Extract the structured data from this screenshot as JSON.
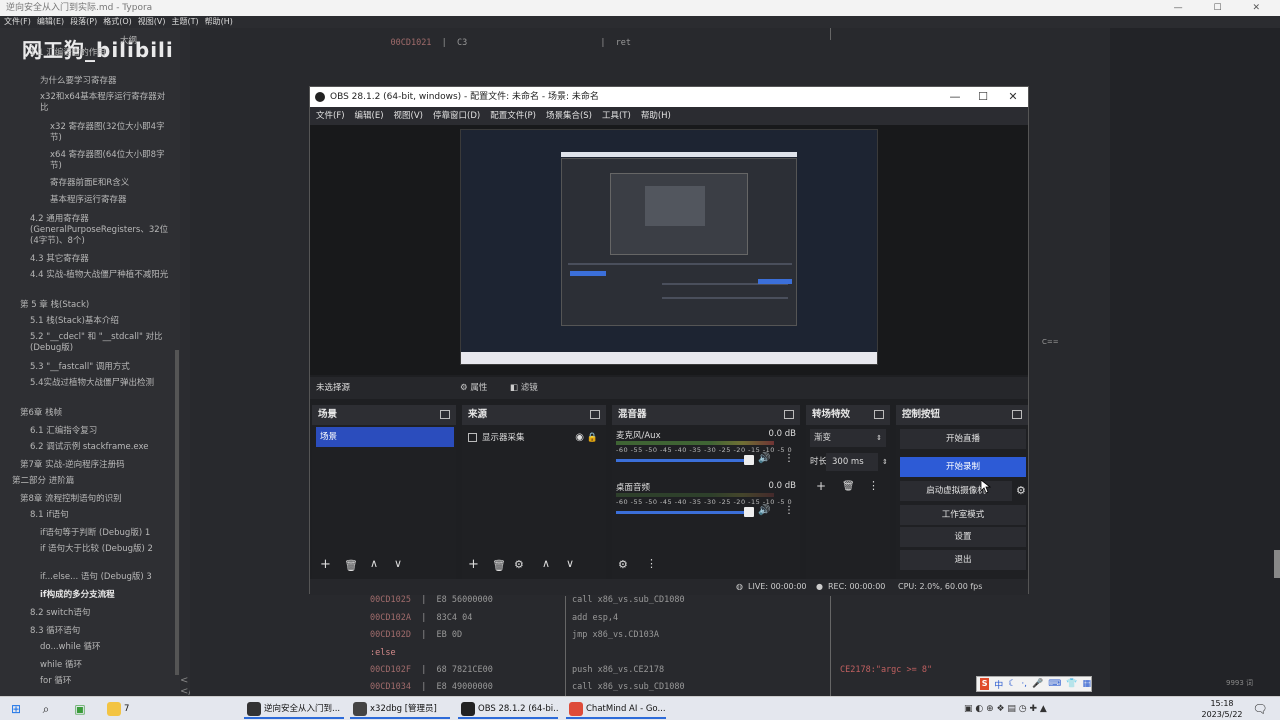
{
  "typora": {
    "window_title": "逆向安全从入门到实际.md - Typora",
    "menu": [
      "文件(F)",
      "编辑(E)",
      "段落(P)",
      "格式(O)",
      "视图(V)",
      "主题(T)",
      "帮助(H)"
    ],
    "watermark": "网工狗_bilibili",
    "outline": [
      {
        "text": "大纲",
        "bold": false
      },
      {
        "text": "1.1 汇编语言的作用",
        "bold": false
      },
      {
        "text": "为什么要学习寄存器",
        "bold": false
      },
      {
        "text": "x32和x64基本程序运行寄存器对比",
        "bold": false
      },
      {
        "text": "x32 寄存器图(32位大小即4字节)",
        "bold": false
      },
      {
        "text": "x64 寄存器图(64位大小即8字节)",
        "bold": false
      },
      {
        "text": "寄存器前面E和R含义",
        "bold": false
      },
      {
        "text": "基本程序运行寄存器",
        "bold": false
      },
      {
        "text": "4.2 通用寄存器(GeneralPurposeRegisters、32位(4字节)、8个)",
        "bold": false
      },
      {
        "text": "4.3 其它寄存器",
        "bold": false
      },
      {
        "text": "4.4 实战-植物大战僵尸种植不减阳光",
        "bold": false
      },
      {
        "text": "第 5 章 栈(Stack)",
        "bold": false
      },
      {
        "text": "5.1 栈(Stack)基本介绍",
        "bold": false
      },
      {
        "text": "5.2 \"__cdecl\" 和 \"__stdcall\" 对比(Debug版)",
        "bold": false
      },
      {
        "text": "5.3 \"__fastcall\" 调用方式",
        "bold": false
      },
      {
        "text": "5.4实战过植物大战僵尸弹出检测",
        "bold": false
      },
      {
        "text": "第6章 栈帧",
        "bold": false
      },
      {
        "text": "6.1 汇编指令复习",
        "bold": false
      },
      {
        "text": "6.2 调试示例 stackframe.exe",
        "bold": false
      },
      {
        "text": "第7章 实战-逆向程序注册码",
        "bold": false
      },
      {
        "text": "第二部分 进阶篇",
        "bold": false
      },
      {
        "text": "第8章 流程控制语句的识别",
        "bold": false
      },
      {
        "text": "8.1 if语句",
        "bold": false
      },
      {
        "text": "if语句等于判断 (Debug版) 1",
        "bold": false
      },
      {
        "text": "if 语句大于比较 (Debug版) 2",
        "bold": false
      },
      {
        "text": "if...else... 语句 (Debug版) 3",
        "bold": false
      },
      {
        "text": "if构成的多分支流程",
        "bold": true
      },
      {
        "text": "8.2 switch语句",
        "bold": false
      },
      {
        "text": "8.3 循环语句",
        "bold": false
      },
      {
        "text": "do...while 循环",
        "bold": false
      },
      {
        "text": "while 循环",
        "bold": false
      },
      {
        "text": "for 循环",
        "bold": false
      }
    ],
    "sidebar_bottom": "< </>",
    "code_top": {
      "addr": "00CD1021",
      "bytes": "C3",
      "instr": "ret"
    },
    "code_lines": [
      {
        "addr": "00CD1025",
        "bytes": "E8 56000000",
        "instr": "call x86_vs.sub_CD1080",
        "comment": ""
      },
      {
        "addr": "00CD102A",
        "bytes": "83C4 04",
        "instr": "add esp,4",
        "comment": ""
      },
      {
        "addr": "00CD102D",
        "bytes": "EB 0D",
        "instr": "jmp x86_vs.CD103A",
        "comment": ""
      },
      {
        "addr": ":else",
        "bytes": "",
        "instr": "",
        "comment": ""
      },
      {
        "addr": "00CD102F",
        "bytes": "68 7821CE00",
        "instr": "push x86_vs.CE2178",
        "comment": "CE2178:\"argc >= 8\""
      },
      {
        "addr": "00CD1034",
        "bytes": "E8 49000000",
        "instr": "call x86_vs.sub_CD1080",
        "comment": ""
      }
    ],
    "right_marker": "C==",
    "word_count": "9993 词"
  },
  "obs": {
    "title": "OBS 28.1.2 (64-bit, windows) - 配置文件: 未命名 - 场景: 未命名",
    "menu": [
      "文件(F)",
      "编辑(E)",
      "视图(V)",
      "停靠窗口(D)",
      "配置文件(P)",
      "场景集合(S)",
      "工具(T)",
      "帮助(H)"
    ],
    "no_source": "未选择源",
    "properties_btn": "属性",
    "filters_btn": "滤镜",
    "docks": {
      "scenes": {
        "title": "场景",
        "items": [
          "场景"
        ]
      },
      "sources": {
        "title": "来源",
        "items": [
          "显示器采集"
        ]
      },
      "mixer": {
        "title": "混音器",
        "channels": [
          {
            "name": "麦克风/Aux",
            "db": "0.0 dB",
            "level": 0.75
          },
          {
            "name": "桌面音频",
            "db": "0.0 dB",
            "level": 0.95
          }
        ],
        "scale": "-60 -55 -50 -45 -40 -35 -30 -25 -20 -15 -10 -5 0"
      },
      "transitions": {
        "title": "转场特效",
        "selected": "渐变",
        "duration_label": "时长",
        "duration": "300 ms"
      },
      "controls": {
        "title": "控制按钮",
        "buttons": [
          "开始直播",
          "开始录制",
          "启动虚拟摄像机",
          "工作室模式",
          "设置",
          "退出"
        ],
        "active": "开始录制"
      }
    },
    "status": {
      "live": "LIVE: 00:00:00",
      "rec": "REC: 00:00:00",
      "cpu": "CPU: 2.0%, 60.00 fps"
    }
  },
  "ime": {
    "label": "中"
  },
  "taskbar": {
    "items": [
      {
        "label": "7",
        "color": "#f3c443"
      },
      {
        "label": "逆向安全从入门到...",
        "color": "#333333"
      },
      {
        "label": "x32dbg [管理员]",
        "color": "#444444"
      },
      {
        "label": "OBS 28.1.2 (64-bi...",
        "color": "#222222"
      },
      {
        "label": "ChatMind AI - Go...",
        "color": "#de4b39"
      }
    ],
    "time": "15:18",
    "date": "2023/5/22"
  }
}
